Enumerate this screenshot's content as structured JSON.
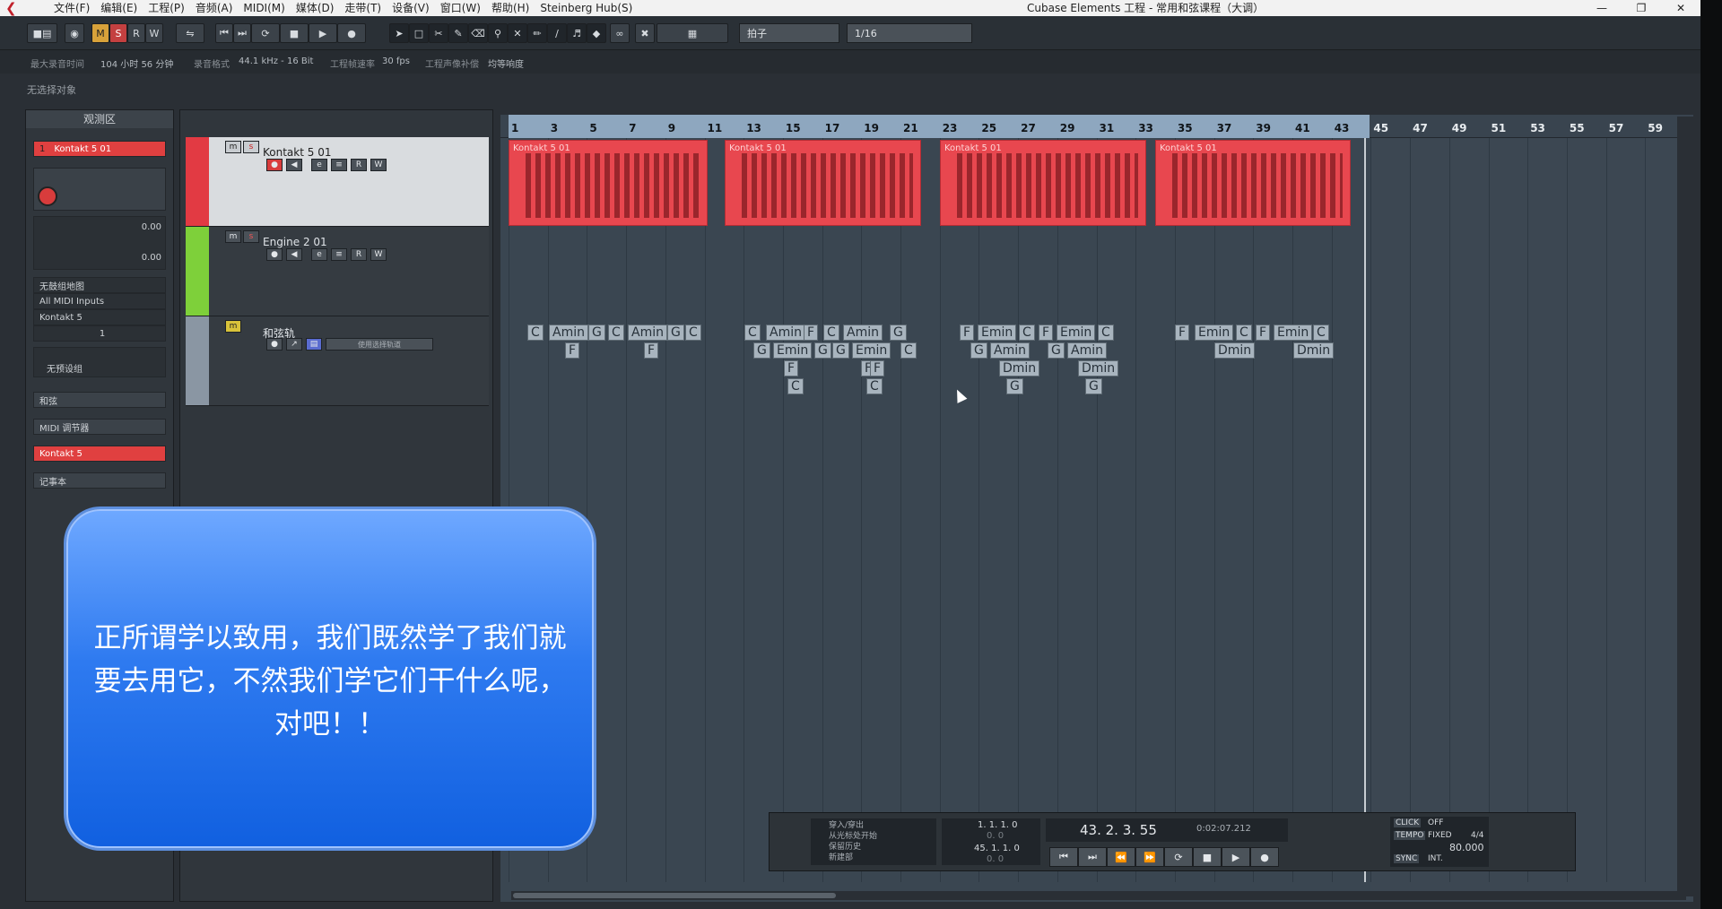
{
  "titlebar": {
    "menu": [
      "文件(F)",
      "编辑(E)",
      "工程(P)",
      "音频(A)",
      "MIDI(M)",
      "媒体(D)",
      "走带(T)",
      "设备(V)",
      "窗口(W)",
      "帮助(H)",
      "Steinberg Hub(S)"
    ],
    "title": "Cubase Elements 工程 - 常用和弦课程（大调）"
  },
  "toolbar": {
    "m": "M",
    "s": "S",
    "r": "R",
    "w": "W",
    "snap_type": "拍子",
    "quantize": "1/16"
  },
  "infobar": {
    "max_record_label": "最大录音时间",
    "max_record": "104 小时 56 分钟",
    "rate_label": "录音格式",
    "rate": "44.1 kHz - 16 Bit",
    "fps_label": "工程帧速率",
    "fps": "30 fps",
    "pan_label": "工程声像补偿",
    "pan": "均等响度"
  },
  "no_selection": "无选择对象",
  "inspector": {
    "title": "观测区",
    "track_num": "1",
    "track_name": "Kontakt 5 01",
    "vol": "0.00",
    "pan": "0.00",
    "no_drum_map": "无鼓组地图",
    "midi_input": "All MIDI Inputs",
    "output": "Kontakt 5",
    "channel": "1",
    "no_bank": "无预设组",
    "chord": "和弦",
    "midi_mod": "MIDI 调节器",
    "instrument": "Kontakt 5",
    "notepad": "记事本"
  },
  "tracks": [
    {
      "num": "1",
      "name": "Kontakt 5 01",
      "color": "#e23a43"
    },
    {
      "num": "2",
      "name": "Engine 2 01",
      "color": "#7ed03a"
    },
    {
      "num": "",
      "name": "和弦轨",
      "color": "#8a96a3",
      "chordpad": "使用选择轨道"
    }
  ],
  "ruler": [
    "1",
    "3",
    "5",
    "7",
    "9",
    "11",
    "13",
    "15",
    "17",
    "19",
    "21",
    "23",
    "25",
    "27",
    "29",
    "31",
    "33",
    "35",
    "37",
    "39",
    "41",
    "43",
    "45",
    "47",
    "49",
    "51",
    "53",
    "55",
    "57",
    "59"
  ],
  "parts": [
    {
      "label": "Kontakt 5 01"
    },
    {
      "label": "Kontakt 5 01"
    },
    {
      "label": "Kontakt 5 01"
    },
    {
      "label": "Kontakt 5 01"
    }
  ],
  "chords": [
    {
      "t": "C"
    },
    {
      "t": "Amin"
    },
    {
      "t": "G"
    },
    {
      "t": "C"
    },
    {
      "t": "Amin"
    },
    {
      "t": "G"
    },
    {
      "t": "C"
    },
    {
      "t": "F"
    },
    {
      "t": "F"
    },
    {
      "t": "C"
    },
    {
      "t": "Amin"
    },
    {
      "t": "F"
    },
    {
      "t": "C"
    },
    {
      "t": "Amin"
    },
    {
      "t": "G"
    },
    {
      "t": "G"
    },
    {
      "t": "Emin"
    },
    {
      "t": "G"
    },
    {
      "t": "G"
    },
    {
      "t": "Emin"
    },
    {
      "t": "C"
    },
    {
      "t": "F"
    },
    {
      "t": "F"
    },
    {
      "t": "F"
    },
    {
      "t": "C"
    },
    {
      "t": "C"
    },
    {
      "t": "F"
    },
    {
      "t": "Emin"
    },
    {
      "t": "C"
    },
    {
      "t": "F"
    },
    {
      "t": "Emin"
    },
    {
      "t": "C"
    },
    {
      "t": "G"
    },
    {
      "t": "Amin"
    },
    {
      "t": "G"
    },
    {
      "t": "Amin"
    },
    {
      "t": "Dmin"
    },
    {
      "t": "Dmin"
    },
    {
      "t": "G"
    },
    {
      "t": "G"
    },
    {
      "t": "F"
    },
    {
      "t": "Emin"
    },
    {
      "t": "C"
    },
    {
      "t": "F"
    },
    {
      "t": "Emin"
    },
    {
      "t": "C"
    },
    {
      "t": "Dmin"
    },
    {
      "t": "Dmin"
    }
  ],
  "transport": {
    "punch": "穿入/穿出",
    "from_marker": "从光标处开始",
    "record_history": "保留历史",
    "new_part": "新建部",
    "l_pos": "1. 1. 1.  0",
    "r_pos": "45. 1. 1.  0",
    "zero": "0.  0",
    "position": "43.  2.  3.  55",
    "time": "0:02:07.212",
    "click": "CLICK",
    "off": "OFF",
    "tempo": "TEMPO",
    "fixed": "FIXED",
    "sig": "4/4",
    "bpm": "80.000",
    "sync": "SYNC",
    "int": "INT."
  },
  "subtitle": "正所谓学以致用，我们既然学了我们就要去用它，不然我们学它们干什么呢，对吧！！"
}
